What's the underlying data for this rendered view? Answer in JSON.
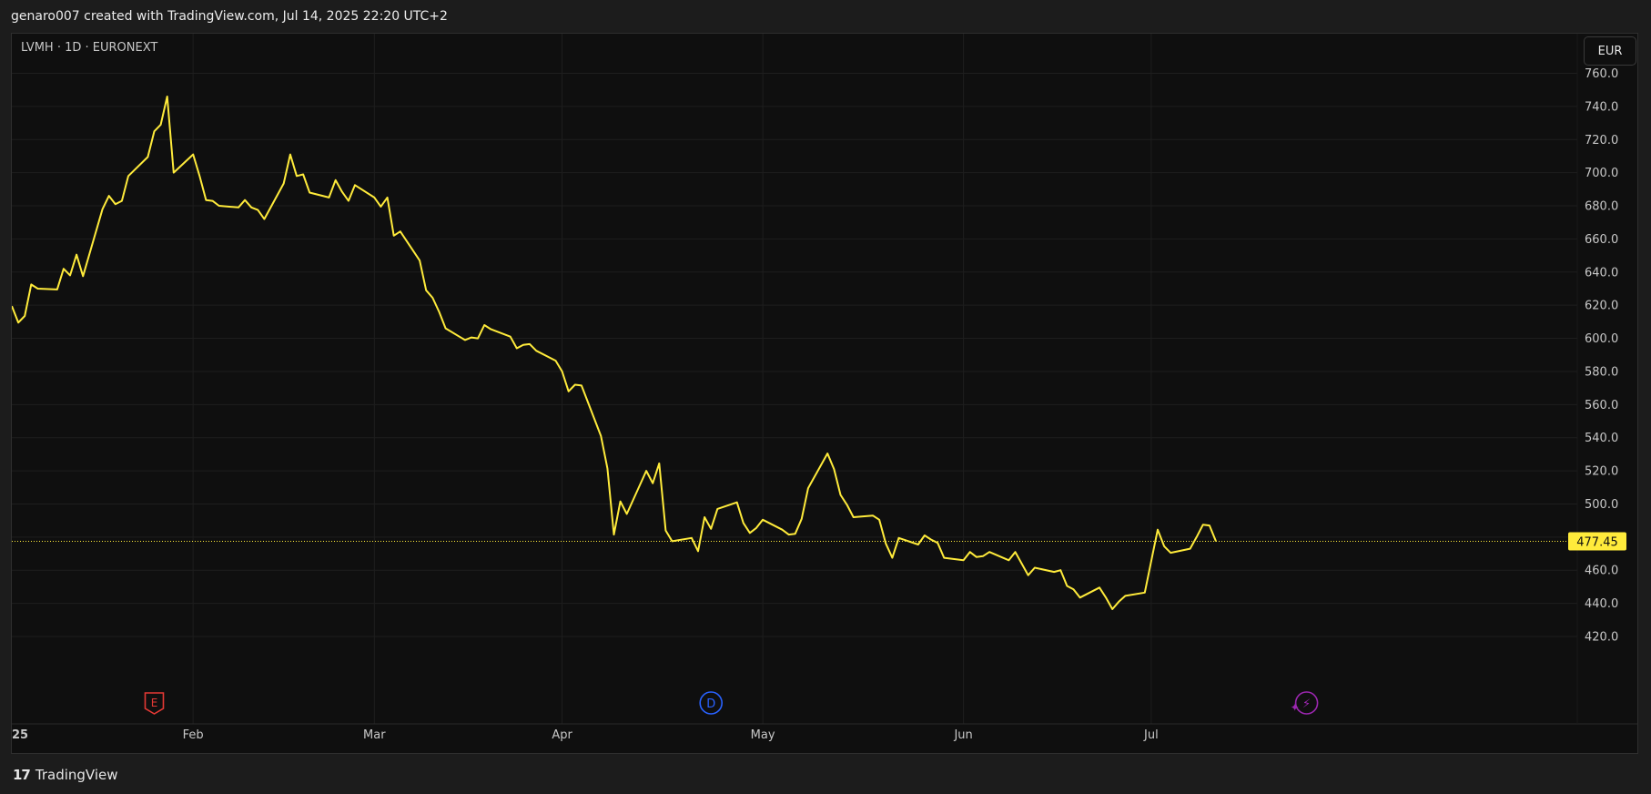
{
  "header": {
    "attribution": "genaro007 created with TradingView.com, Jul 14, 2025 22:20 UTC+2"
  },
  "chart_header": {
    "symbol": "LVMH · 1D · EURONEXT",
    "currency": "EUR"
  },
  "footer": {
    "logo_mark": "17",
    "logo_text": "TradingView"
  },
  "colors": {
    "line": "#ffeb3b",
    "background": "#0f0f0f",
    "grid": "#1e1e1e",
    "earnings_marker": "#e53935",
    "dividend_marker": "#2962ff",
    "split_marker": "#9c27b0"
  },
  "chart_data": {
    "type": "line",
    "title": "LVMH · 1D · EURONEXT",
    "ylim": [
      410,
      766
    ],
    "yticks": [
      420,
      440,
      460,
      480,
      500,
      520,
      540,
      560,
      580,
      600,
      620,
      640,
      660,
      680,
      700,
      720,
      740,
      760
    ],
    "ytick_labels": [
      "420.0",
      "440.0",
      "460.0",
      "480.0",
      "500.0",
      "520.0",
      "540.0",
      "560.0",
      "580.0",
      "600.0",
      "620.0",
      "640.0",
      "660.0",
      "680.0",
      "700.0",
      "720.0",
      "740.0",
      "760.0"
    ],
    "x_start": "2025-01-06",
    "x_labels": [
      {
        "label": "25",
        "date": "2025-01-01"
      },
      {
        "label": "Feb",
        "date": "2025-02-03"
      },
      {
        "label": "Mar",
        "date": "2025-03-03"
      },
      {
        "label": "Apr",
        "date": "2025-04-01"
      },
      {
        "label": "May",
        "date": "2025-05-02"
      },
      {
        "label": "Jun",
        "date": "2025-06-02"
      },
      {
        "label": "Jul",
        "date": "2025-07-01"
      }
    ],
    "last_price": 477.45,
    "last_price_label": "477.45",
    "grid": true,
    "markers": [
      {
        "type": "earnings",
        "label": "E",
        "date": "2025-01-28"
      },
      {
        "type": "dividend",
        "label": "D",
        "date": "2025-04-24"
      },
      {
        "type": "split",
        "label": "⚡",
        "date": "2025-07-25"
      }
    ],
    "series": [
      {
        "values": [
          619.5,
          609.5,
          613.5,
          632.5,
          630.0,
          629.5,
          642.0,
          638.0,
          650.5,
          637.5,
          678.0,
          686.0,
          681.0,
          683.0,
          698.0,
          709.5,
          725.0,
          729.0,
          746.0,
          700.0,
          711.0,
          698.0,
          683.5,
          683.0,
          680.0,
          679.0,
          683.5,
          679.0,
          677.5,
          672.0,
          693.5,
          711.0,
          698.0,
          699.0,
          688.0,
          685.0,
          695.5,
          688.5,
          683.0,
          692.5,
          685.0,
          679.5,
          685.0,
          662.0,
          664.5,
          647.0,
          629.0,
          624.5,
          616.0,
          606.0,
          599.0,
          600.5,
          600.0,
          608.0,
          605.5,
          601.0,
          594.0,
          596.0,
          596.5,
          592.5,
          586.5,
          580.0,
          568.0,
          572.0,
          571.5,
          541.0,
          521.5,
          481.5,
          501.5,
          494.0,
          520.0,
          512.5,
          524.5,
          484.0,
          477.5,
          479.5,
          471.5,
          492.0,
          485.0,
          497.0,
          501.0,
          488.5,
          482.5,
          485.5,
          490.5,
          484.5,
          481.5,
          482.0,
          491.0,
          509.5,
          530.5,
          521.0,
          505.5,
          499.5,
          492.0,
          493.0,
          490.5,
          476.0,
          467.5,
          479.5,
          475.5,
          481.0,
          478.5,
          476.5,
          467.5,
          466.0,
          471.0,
          468.0,
          468.5,
          471.0,
          466.0,
          471.0,
          464.0,
          457.0,
          461.5,
          459.0,
          460.0,
          450.5,
          448.5,
          443.5,
          449.5,
          443.5,
          436.5,
          441.0,
          444.5,
          446.5,
          465.5,
          484.5,
          474.5,
          470.5,
          473.0,
          480.0,
          487.5,
          487.0,
          477.45
        ]
      }
    ]
  }
}
